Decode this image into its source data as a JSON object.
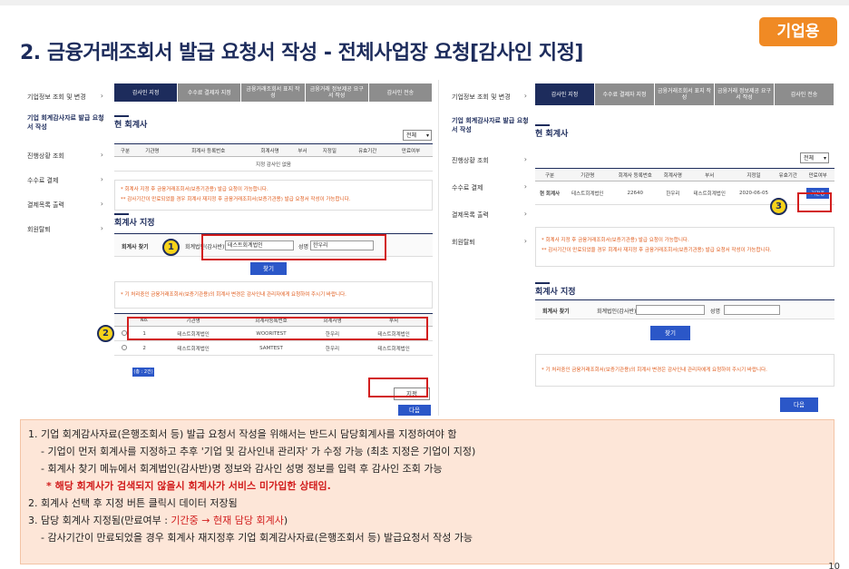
{
  "title": "2. 금융거래조회서 발급 요청서 작성 - 전체사업장 요청[감사인 지정]",
  "badge": "기업용",
  "sidebar": [
    {
      "label": "기업정보 조회 및 변경"
    },
    {
      "label": "기업 회계감사자료 발급 요청서 작성"
    },
    {
      "label": "진행상황 조회"
    },
    {
      "label": "수수료 결제"
    },
    {
      "label": "결제목록 출력"
    },
    {
      "label": "회원탈퇴"
    }
  ],
  "steps": [
    "감사인 지정",
    "수수료 결제자 지정",
    "금융거래조회서 표지 작성",
    "금융거래 정보제공 요구서 작성",
    "감사인 전송"
  ],
  "left": {
    "section_current": "현 회계사",
    "filter": "전체",
    "current_headers": [
      "구분",
      "기관명",
      "회계사 등록번호",
      "회계사명",
      "부서",
      "지정일",
      "유효기간",
      "만료여부"
    ],
    "empty_text": "지정 감사인 없음",
    "note1": "* 회계사 지정 후 금융거래조회서(보증기관용) 발급 요청이 가능합니다.",
    "note2": "** 감사기간이 만료되었을 경우 회계사 재지정 후 금융거래조회서(보증기관용) 발급 요청서 작성이 가능합니다.",
    "section_assign": "회계사 지정",
    "search_label": "회계사 찾기",
    "firm_label": "회계법인(감사반)명",
    "firm_value": "테스트회계법인",
    "name_label": "성명",
    "name_value": "한우리",
    "search_button": "찾기",
    "note3": "* 기 처리중인 금융거래조회서(보증기관용)의 회계사 변경은 감사인내 관리자에게 요청하여 주시기 바랍니다.",
    "result_headers": [
      "No.",
      "기관명",
      "회계사등록번호",
      "회계사명",
      "부서"
    ],
    "results": [
      {
        "no": "1",
        "org": "테스트회계법인",
        "reg": "WOORITEST",
        "name": "한우리",
        "dept": "테스트회계법인"
      },
      {
        "no": "2",
        "org": "테스트회계법인",
        "reg": "SAMTEST",
        "name": "한우리",
        "dept": "테스트회계법인"
      }
    ],
    "total": "(총 : 2건)",
    "assign_button": "지정",
    "next_button": "다음"
  },
  "right": {
    "section_current": "현 회계사",
    "filter": "전체",
    "current_headers": [
      "구분",
      "기관명",
      "회계사 등록번호",
      "회계사명",
      "부서",
      "지정일",
      "유효기간",
      "만료여부"
    ],
    "row": {
      "type": "현 회계사",
      "org": "테스트회계법인",
      "reg": "22640",
      "name": "한우리",
      "dept": "테스트회계법인",
      "date": "2020-06-05",
      "valid": "",
      "status": "기간중"
    },
    "note1": "* 회계사 지정 후 금융거래조회서(보증기관용) 발급 요청이 가능합니다.",
    "note2": "** 감사기간이 만료되었을 경우 회계사 재지정 후 금융거래조회서(보증기관용) 발급 요청서 작성이 가능합니다.",
    "section_assign": "회계사 지정",
    "search_label": "회계사 찾기",
    "firm_label": "회계법인(감사반)명",
    "name_label": "성명",
    "search_button": "찾기",
    "note3": "* 기 처리중인 금융거래조회서(보증기관용)의 회계사 변경은 감사인내 관리자에게 요청하여 주시기 바랍니다.",
    "next_button": "다음"
  },
  "markers": [
    "1",
    "2",
    "3"
  ],
  "bottom": {
    "l1": "1. 기업 회계감사자료(은행조회서 등) 발급 요청서 작성을 위해서는 반드시 담당회계사를 지정하여야 함",
    "l2": "- 기업이 먼저 회계사를 지정하고 추후 '기업 및 감사인내 관리자' 가 수정 가능 (최초 지정은 기업이 지정)",
    "l3": "- 회계사 찾기 메뉴에서 회계법인(감사반)명 정보와 감사인 성명 정보를 입력 후 감사인 조회 가능",
    "l4": "* 해당 회계사가 검색되지 않을시 회계사가 서비스 미가입한 상태임.",
    "l5": "2. 회계사 선택 후 지정 버튼 클릭시 데이터 저장됨",
    "l6a": "3. 담당 회계사 지정됨(만료여부 : ",
    "l6b": "기간중 → 현재 담당 회계사",
    "l6c": ")",
    "l7": "- 감사기간이 만료되었을 경우 회계사 재지정후 기업 회계감사자료(은행조회서 등) 발급요청서 작성 가능"
  },
  "page_number": "10"
}
